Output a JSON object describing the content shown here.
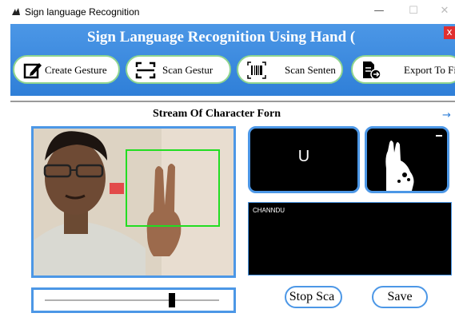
{
  "window": {
    "title": "Sign language Recognition",
    "minimize_glyph": "—",
    "maximize_glyph": "☐",
    "close_glyph": "✕"
  },
  "header": {
    "title": "Sign Language Recognition Using Hand (",
    "close_glyph": "x",
    "accent_color": "#3a8ae0"
  },
  "toolbar": {
    "buttons": [
      {
        "label": "Create Gesture",
        "icon": "edit-icon"
      },
      {
        "label": "Scan Gestur",
        "icon": "scan-icon"
      },
      {
        "label": "Scan Senten",
        "icon": "barcode-icon"
      },
      {
        "label": "Export To Fi",
        "icon": "export-file-icon"
      }
    ]
  },
  "stream": {
    "title": "Stream Of Character Forn",
    "arrow": "→"
  },
  "recognized": {
    "character": "U",
    "sentence": "CHANNDU"
  },
  "controls": {
    "stop_label": "Stop Sca",
    "save_label": "Save",
    "slider_value": 0.73
  }
}
